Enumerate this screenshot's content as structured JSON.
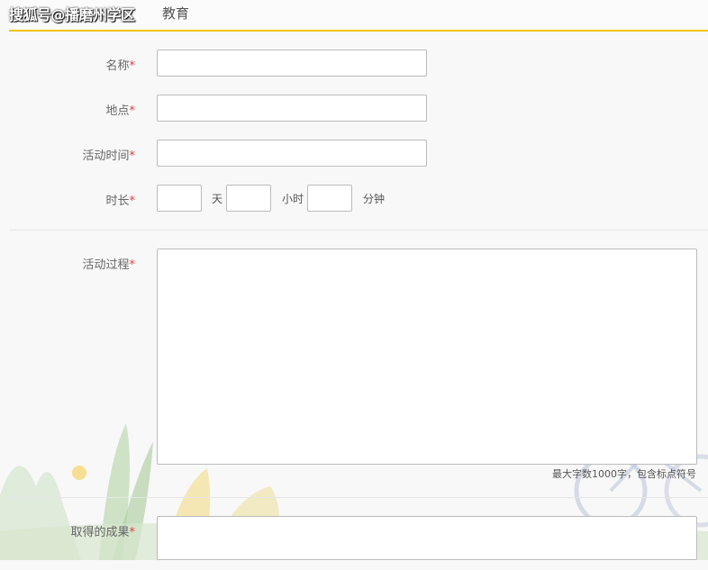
{
  "watermark": "搜狐号@播磨州学区",
  "header": {
    "title": "教育"
  },
  "form": {
    "name": {
      "label": "名称",
      "required_mark": "*",
      "value": ""
    },
    "location": {
      "label": "地点",
      "required_mark": "*",
      "value": ""
    },
    "activity_time": {
      "label": "活动时间",
      "required_mark": "*",
      "value": ""
    },
    "duration": {
      "label": "时长",
      "required_mark": "*",
      "days_value": "",
      "days_unit": "天",
      "hours_value": "",
      "hours_unit": "小时",
      "minutes_value": "",
      "minutes_unit": "分钟"
    },
    "process": {
      "label": "活动过程",
      "required_mark": "*",
      "value": "",
      "hint": "最大字数1000字，包含标点符号"
    },
    "results": {
      "label": "取得的成果",
      "required_mark": "*",
      "value": ""
    }
  }
}
